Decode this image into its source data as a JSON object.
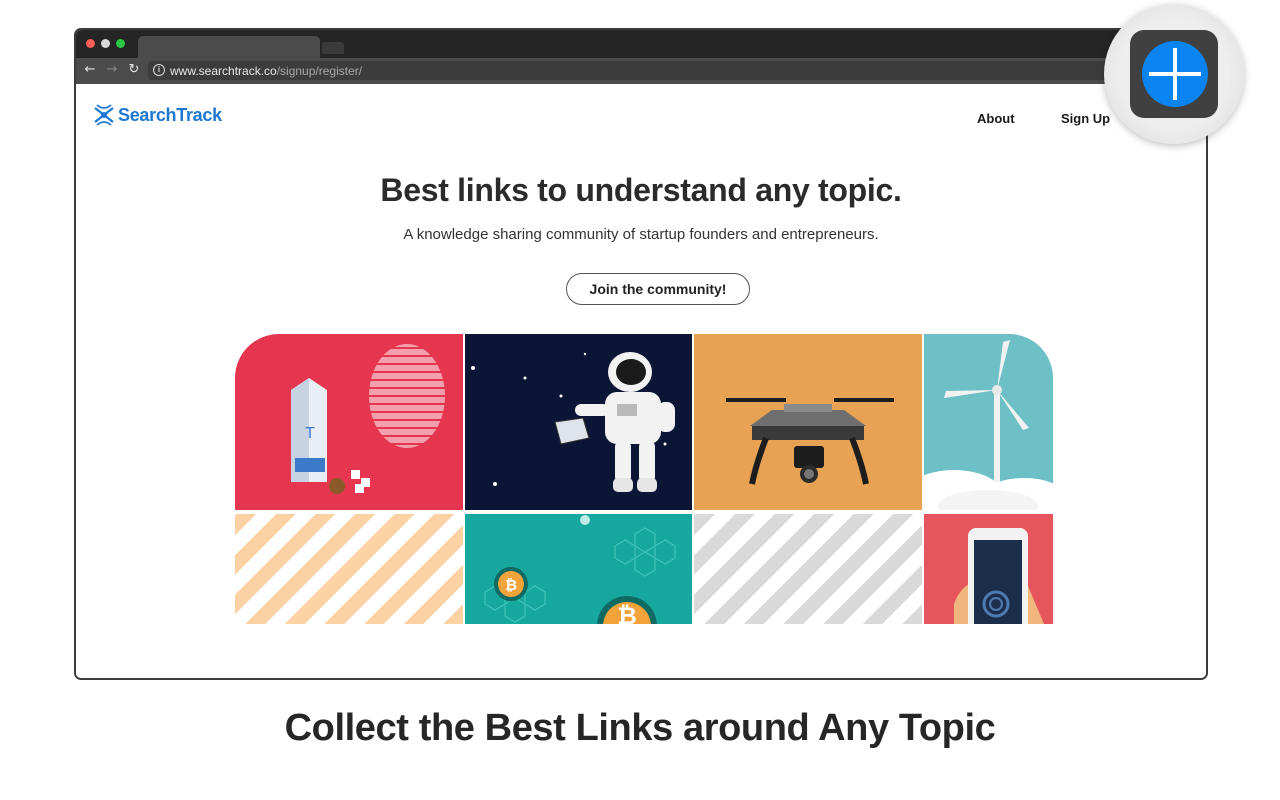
{
  "browser": {
    "url_host": "www.searchtrack.co",
    "url_path": "/signup/register/",
    "icons": [
      "back-arrow-icon",
      "forward-arrow-icon",
      "reload-icon",
      "info-icon"
    ]
  },
  "site": {
    "logo_text": "SearchTrack",
    "nav": {
      "about": "About",
      "signup": "Sign Up"
    },
    "headline": "Best links to understand any topic.",
    "subline": "A knowledge sharing community of startup founders and entrepreneurs.",
    "cta": "Join the community!",
    "brand_color": "#1e78d2"
  },
  "grid": {
    "tiles": [
      "milk-carton-illustration",
      "astronaut-illustration",
      "drone-illustration",
      "wind-turbine-illustration",
      "stripes-peach",
      "bitcoin-illustration",
      "stripes-gray",
      "smartphone-illustration"
    ],
    "colors": {
      "red": "#e6354f",
      "navy": "#0b1535",
      "orange": "#e8a253",
      "teal": "#6cc0c6",
      "peach": "#fcd2a4",
      "green": "#16a89f",
      "gray": "#d9d9d9",
      "phone_red": "#e6545c"
    }
  },
  "caption": "Collect the Best Links around Any Topic",
  "extension": {
    "icon": "add-plus-icon",
    "color": "#0a84f0"
  }
}
